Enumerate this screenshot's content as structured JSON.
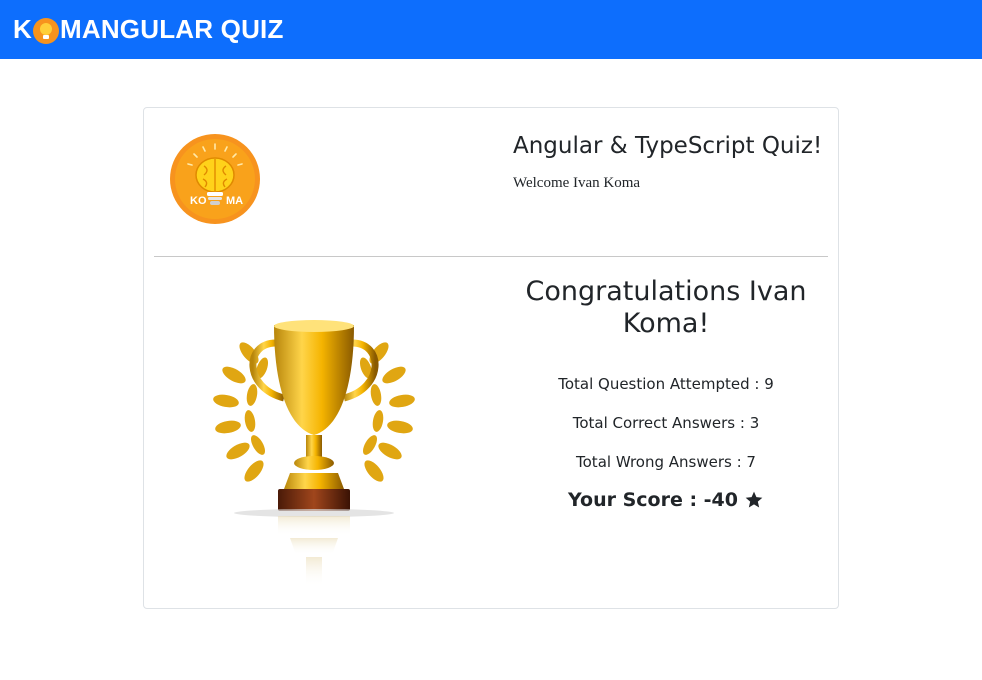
{
  "navbar": {
    "brand_prefix": "K",
    "brand_suffix": "MANGULAR QUIZ",
    "brand_icon": "bulb-o-icon",
    "bg_color": "#0d6efd"
  },
  "card": {
    "logo": {
      "icon": "brain-bulb-logo",
      "left_text": "KO",
      "right_text": "MA",
      "bg_color": "#f7931e"
    },
    "quiz_title": "Angular & TypeScript Quiz!",
    "welcome": "Welcome Ivan Koma",
    "trophy_icon": "trophy-image",
    "congratulations": "Congratulations Ivan Koma!",
    "stats": {
      "attempted": "Total Question Attempted : 9",
      "correct": "Total Correct Answers : 3",
      "wrong": "Total Wrong Answers : 7"
    },
    "score": "Your Score : -40",
    "score_icon": "star-icon"
  }
}
